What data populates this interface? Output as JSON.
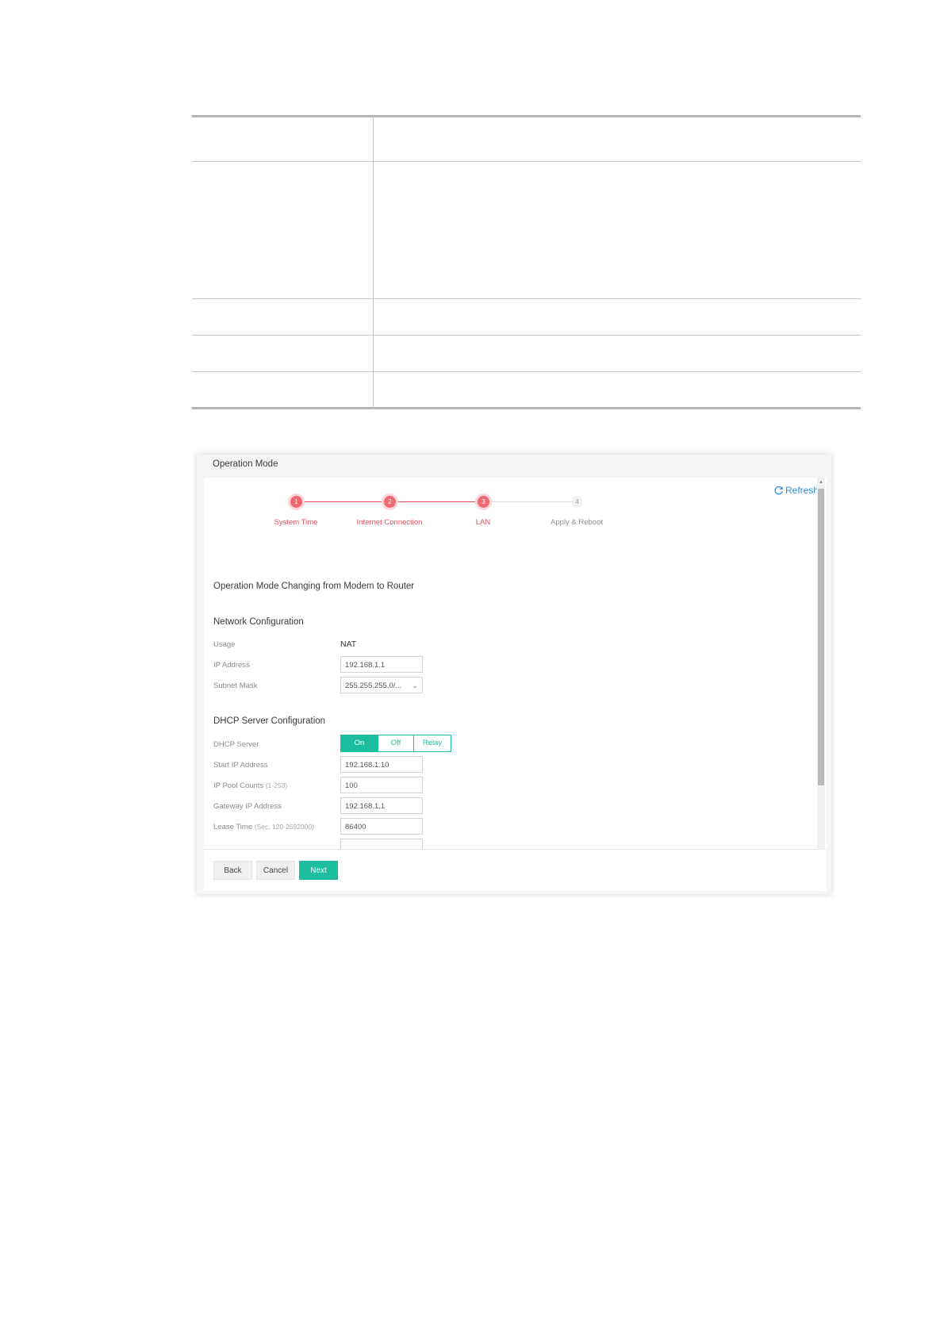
{
  "panel": {
    "title": "Operation Mode",
    "refresh_label": "Refresh"
  },
  "stepper": {
    "steps": [
      {
        "number": "1",
        "label": "System Time",
        "status": "done"
      },
      {
        "number": "2",
        "label": "Internet Connection",
        "status": "done"
      },
      {
        "number": "3",
        "label": "LAN",
        "status": "done"
      },
      {
        "number": "4",
        "label": "Apply & Reboot",
        "status": "todo"
      }
    ]
  },
  "content": {
    "mode_change_heading": "Operation Mode Changing from Modem to Router",
    "network_heading": "Network Configuration",
    "usage_label": "Usage",
    "usage_value": "NAT",
    "ip_label": "IP Address",
    "ip_value": "192.168.1.1",
    "subnet_label": "Subnet Mask",
    "subnet_value": "255.255.255.0/...",
    "dhcp_heading": "DHCP Server Configuration",
    "dhcp_server_label": "DHCP Server",
    "dhcp_options": [
      "On",
      "Off",
      "Relay"
    ],
    "dhcp_selected": "On",
    "start_ip_label": "Start IP Address",
    "start_ip_value": "192.168.1.10",
    "pool_label": "IP Pool Counts",
    "pool_hint": "(1-253)",
    "pool_value": "100",
    "gateway_label": "Gateway IP Address",
    "gateway_value": "192.168.1.1",
    "lease_label": "Lease Time",
    "lease_hint": "(Sec, 120-2592000)",
    "lease_value": "86400"
  },
  "footer": {
    "back_label": "Back",
    "cancel_label": "Cancel",
    "next_label": "Next"
  },
  "colors": {
    "accent_green": "#1cbf9d",
    "step_red": "#ee6a73",
    "link_blue": "#2a8fd8"
  }
}
